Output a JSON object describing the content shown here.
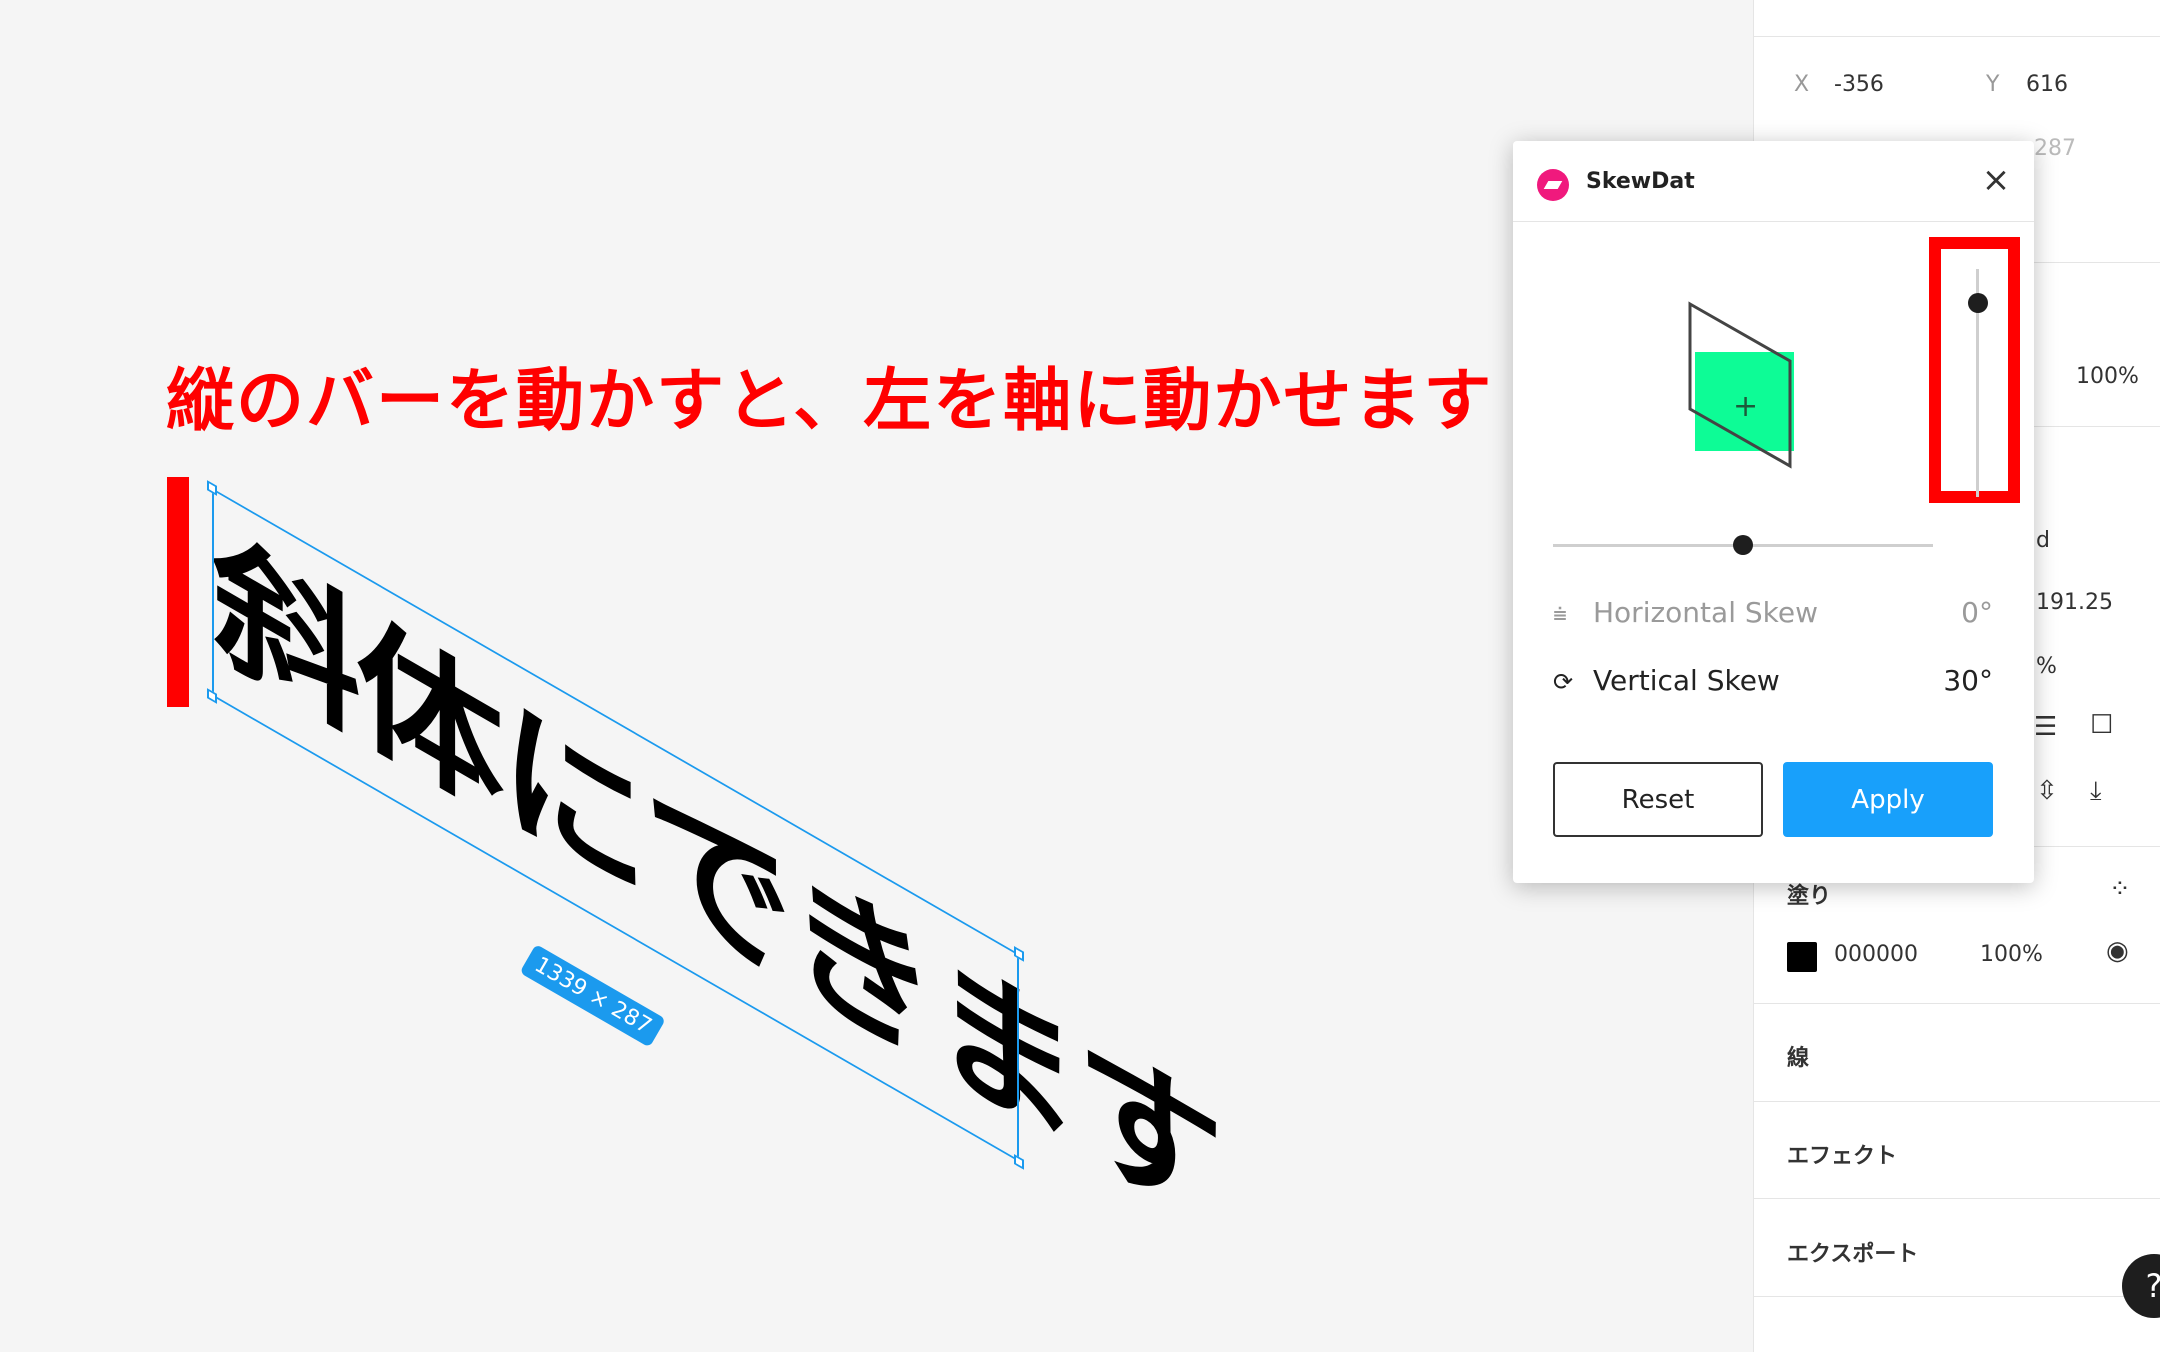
{
  "canvas": {
    "annotation": "縦のバーを動かすと、左を軸に動かせます",
    "skewed_text": "斜体にできます",
    "size_badge": "1339 × 287"
  },
  "panel": {
    "x_label": "X",
    "x_value": "-356",
    "y_label": "Y",
    "y_value": "616",
    "partial_value_1": "287",
    "opacity_1": "100%",
    "partial_text_d": "d",
    "partial_value_2": "191.25",
    "partial_percent": "%",
    "fill_title": "塗り",
    "fill_hex": "000000",
    "fill_opacity": "100%",
    "stroke_title": "線",
    "effects_title": "エフェクト",
    "export_title": "エクスポート",
    "fill_color": "#000000"
  },
  "dialog": {
    "title": "SkewDat",
    "horizontal_label": "Horizontal Skew",
    "horizontal_value": "0°",
    "vertical_label": "Vertical Skew",
    "vertical_value": "30°",
    "reset_label": "Reset",
    "apply_label": "Apply",
    "horizontal_slider_value": 0.5,
    "vertical_slider_value": 0.85
  },
  "help": {
    "label": "?"
  },
  "colors": {
    "accent": "#18a0fb",
    "highlight": "#ff0000",
    "preview": "#0dfc96"
  }
}
